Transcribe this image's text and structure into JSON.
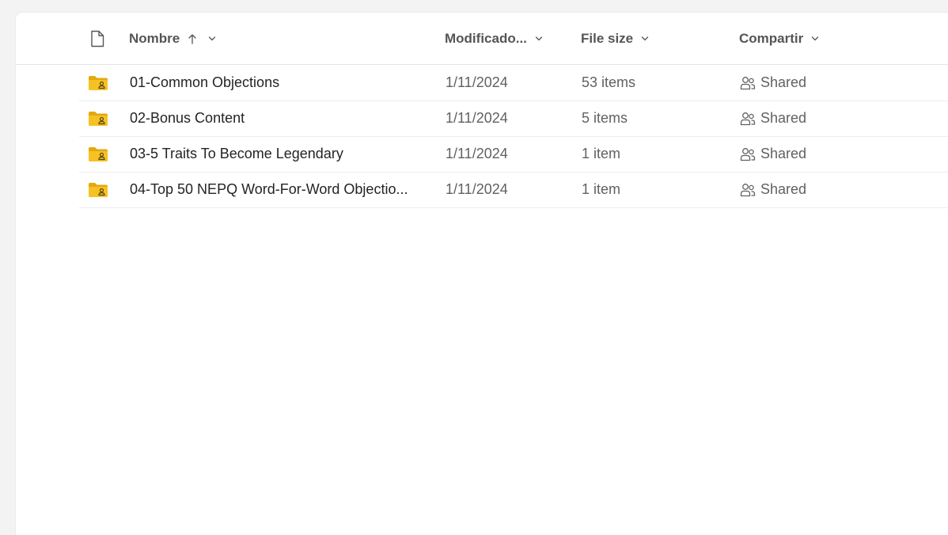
{
  "header": {
    "name_label": "Nombre",
    "modified_label": "Modificado...",
    "size_label": "File size",
    "share_label": "Compartir"
  },
  "rows": [
    {
      "name": "01-Common Objections",
      "modified": "1/11/2024",
      "size": "53 items",
      "sharing": "Shared"
    },
    {
      "name": "02-Bonus Content",
      "modified": "1/11/2024",
      "size": "5 items",
      "sharing": "Shared"
    },
    {
      "name": "03-5 Traits To Become Legendary",
      "modified": "1/11/2024",
      "size": "1 item",
      "sharing": "Shared"
    },
    {
      "name": "04-Top 50 NEPQ Word-For-Word Objectio...",
      "modified": "1/11/2024",
      "size": "1 item",
      "sharing": "Shared"
    }
  ],
  "icons": {
    "file_type": "file-icon",
    "folder": "shared-folder-icon",
    "sort": "arrow-up-icon",
    "chevron": "chevron-down-icon",
    "shared": "people-icon"
  },
  "colors": {
    "folder": "#f6c223",
    "folder_dark": "#e2a90c"
  }
}
